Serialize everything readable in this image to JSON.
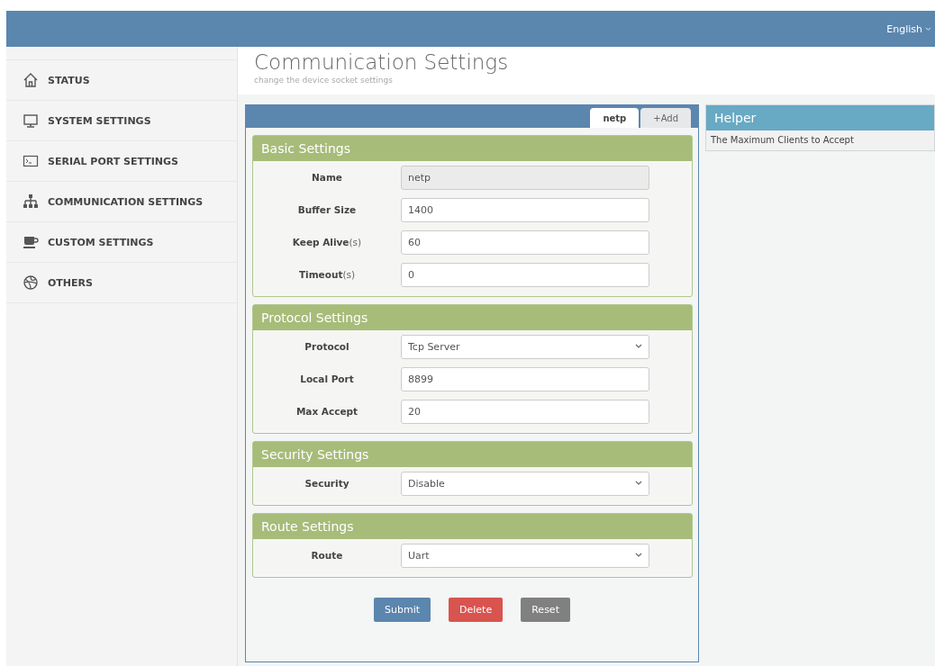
{
  "top_bar": {
    "language": "English"
  },
  "sidebar": {
    "items": [
      {
        "label": "STATUS"
      },
      {
        "label": "SYSTEM SETTINGS"
      },
      {
        "label": "SERIAL PORT SETTINGS"
      },
      {
        "label": "COMMUNICATION SETTINGS"
      },
      {
        "label": "CUSTOM SETTINGS"
      },
      {
        "label": "OTHERS"
      }
    ]
  },
  "page": {
    "title": "Communication Settings",
    "subtitle": "change the device socket settings"
  },
  "tabs": [
    {
      "label": "netp",
      "selected": true
    },
    {
      "label": "+Add",
      "selected": false
    }
  ],
  "sections": [
    {
      "title": "Basic Settings",
      "fields": [
        {
          "label": "Name",
          "kind": "text",
          "value": "netp",
          "disabled": true
        },
        {
          "label": "Buffer Size",
          "kind": "text",
          "value": "1400",
          "disabled": false
        },
        {
          "label": "Keep Alive",
          "unit": "(s)",
          "kind": "text",
          "value": "60",
          "disabled": false
        },
        {
          "label": "Timeout",
          "unit": "(s)",
          "kind": "text",
          "value": "0",
          "disabled": false
        }
      ]
    },
    {
      "title": "Protocol Settings",
      "fields": [
        {
          "label": "Protocol",
          "kind": "select",
          "value": "Tcp Server"
        },
        {
          "label": "Local Port",
          "kind": "text",
          "value": "8899",
          "disabled": false
        },
        {
          "label": "Max Accept",
          "kind": "text",
          "value": "20",
          "disabled": false
        }
      ]
    },
    {
      "title": "Security Settings",
      "fields": [
        {
          "label": "Security",
          "kind": "select",
          "value": "Disable"
        }
      ]
    },
    {
      "title": "Route Settings",
      "fields": [
        {
          "label": "Route",
          "kind": "select",
          "value": "Uart"
        }
      ]
    }
  ],
  "buttons": [
    {
      "label": "Submit",
      "kind": "primary"
    },
    {
      "label": "Delete",
      "kind": "danger"
    },
    {
      "label": "Reset",
      "kind": "neutral"
    }
  ],
  "helper": {
    "title": "Helper",
    "text": "The Maximum Clients to Accept"
  }
}
